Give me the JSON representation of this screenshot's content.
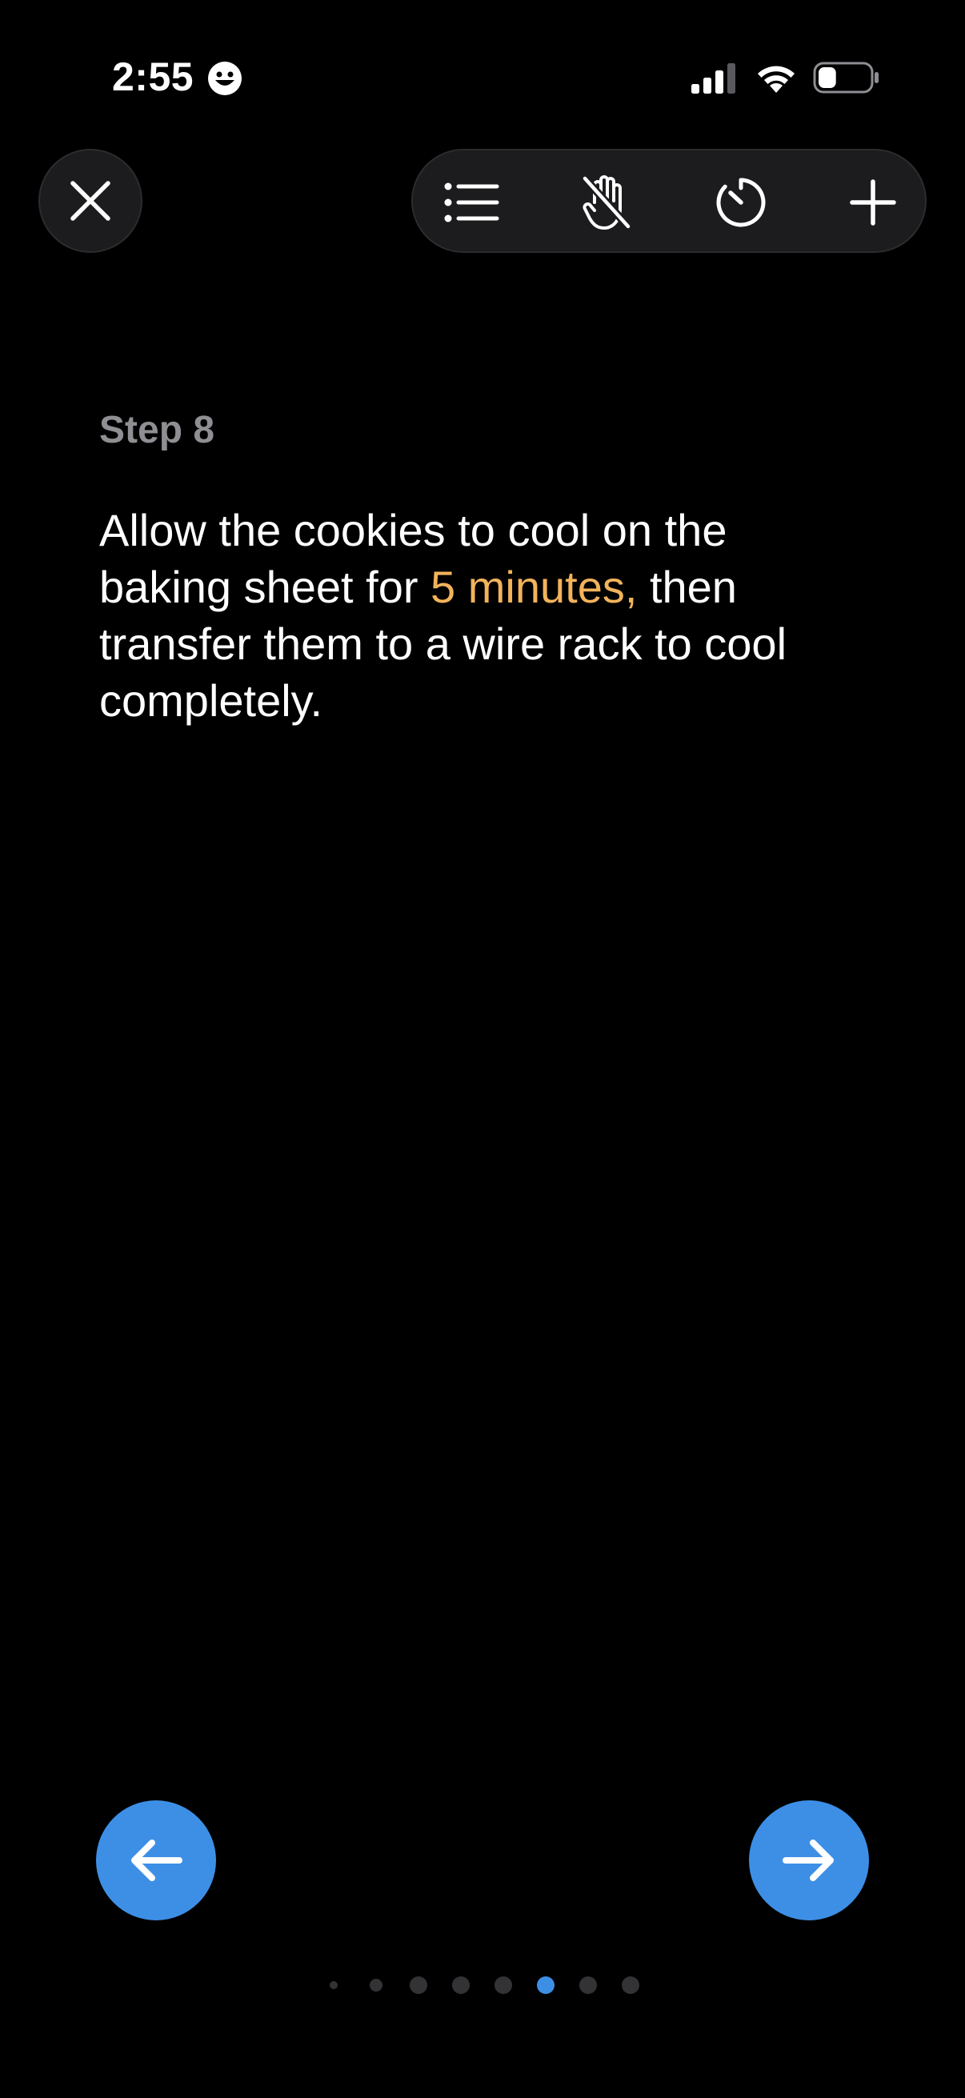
{
  "status_bar": {
    "time": "2:55",
    "emoji_icon": "grinning-face-icon",
    "signal_icon": "cellular-signal-icon",
    "wifi_icon": "wifi-icon",
    "battery_icon": "battery-icon",
    "battery_level": 0.35
  },
  "toolbar": {
    "close_icon": "close-icon",
    "buttons": [
      {
        "icon": "list-icon"
      },
      {
        "icon": "hands-free-off-icon"
      },
      {
        "icon": "timer-icon"
      },
      {
        "icon": "plus-icon"
      }
    ]
  },
  "step": {
    "label": "Step 8",
    "text_before": "Allow the cookies to cool on the baking sheet for ",
    "highlight": "5 minutes,",
    "text_after": " then transfer them to a wire rack to cool completely."
  },
  "navigation": {
    "prev_icon": "arrow-left-icon",
    "next_icon": "arrow-right-icon"
  },
  "pagination": {
    "total": 8,
    "current": 6
  },
  "colors": {
    "background": "#000000",
    "accent": "#3d8fe6",
    "highlight": "#f2b35b",
    "muted": "#8e8e93",
    "dot_inactive": "#333336"
  }
}
